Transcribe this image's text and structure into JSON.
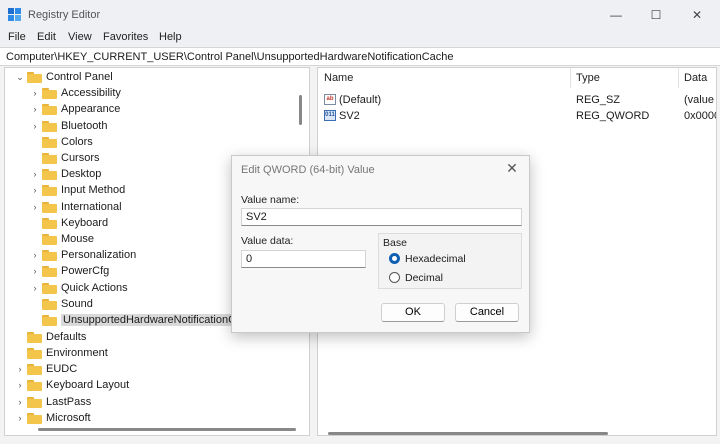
{
  "window": {
    "title": "Registry Editor",
    "minimize": "—",
    "maximize": "☐",
    "close": "✕"
  },
  "menu": [
    "File",
    "Edit",
    "View",
    "Favorites",
    "Help"
  ],
  "address": "Computer\\HKEY_CURRENT_USER\\Control Panel\\UnsupportedHardwareNotificationCache",
  "tree": {
    "root": "Control Panel",
    "children": [
      "Accessibility",
      "Appearance",
      "Bluetooth",
      "Colors",
      "Cursors",
      "Desktop",
      "Input Method",
      "International",
      "Keyboard",
      "Mouse",
      "Personalization",
      "PowerCfg",
      "Quick Actions",
      "Sound",
      "UnsupportedHardwareNotificationC"
    ],
    "siblings": [
      "Defaults",
      "Environment",
      "EUDC",
      "Keyboard Layout",
      "LastPass",
      "Microsoft"
    ]
  },
  "list": {
    "columns": [
      "Name",
      "Type",
      "Data"
    ],
    "rows": [
      {
        "name": "(Default)",
        "type": "REG_SZ",
        "data": "(value",
        "icon": "ab"
      },
      {
        "name": "SV2",
        "type": "REG_QWORD",
        "data": "0x0000",
        "icon": "011"
      }
    ]
  },
  "dialog": {
    "title": "Edit QWORD (64-bit) Value",
    "value_name_label": "Value name:",
    "value_name": "SV2",
    "value_data_label": "Value data:",
    "value_data": "0",
    "base_label": "Base",
    "hex_label": "Hexadecimal",
    "dec_label": "Decimal",
    "ok_label": "OK",
    "cancel_label": "Cancel",
    "close": "✕"
  }
}
